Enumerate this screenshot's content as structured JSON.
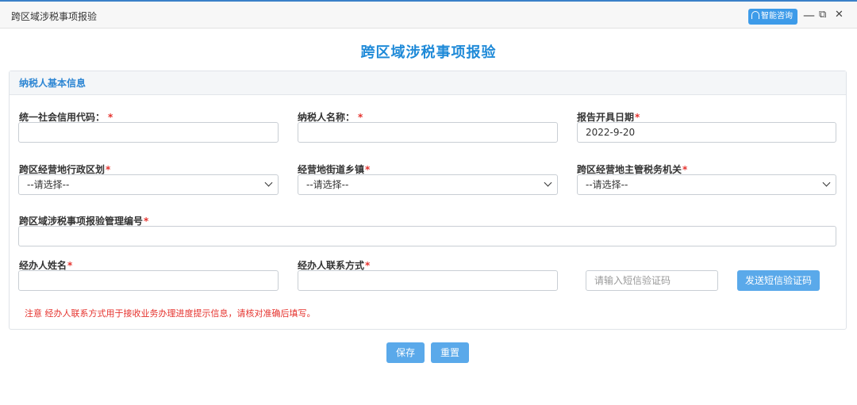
{
  "window": {
    "title": "跨区域涉税事项报验",
    "assist_label": "智能咨询",
    "minimize_glyph": "—",
    "restore_glyph": "⧉",
    "close_glyph": "✕"
  },
  "page": {
    "title": "跨区域涉税事项报验"
  },
  "panel": {
    "heading": "纳税人基本信息",
    "fields": {
      "credit_code": {
        "label": "统一社会信用代码：",
        "value": ""
      },
      "taxpayer_name": {
        "label": "纳税人名称：",
        "value": ""
      },
      "report_date": {
        "label": "报告开具日期",
        "value": "2022-9-20"
      },
      "admin_region": {
        "label": "跨区经营地行政区划",
        "selected": "--请选择--"
      },
      "street_town": {
        "label": "经营地街道乡镇",
        "selected": "--请选择--"
      },
      "tax_authority": {
        "label": "跨区经营地主管税务机关",
        "selected": "--请选择--"
      },
      "mgmt_number": {
        "label": "跨区域涉税事项报验管理编号",
        "value": ""
      },
      "agent_name": {
        "label": "经办人姓名",
        "value": ""
      },
      "agent_contact": {
        "label": "经办人联系方式",
        "value": ""
      },
      "sms_code": {
        "placeholder": "请输入短信验证码",
        "value": ""
      }
    },
    "required_mark": "*",
    "send_sms_label": "发送短信验证码",
    "notice": "注意 经办人联系方式用于接收业务办理进度提示信息，请核对准确后填写。"
  },
  "actions": {
    "save_label": "保存",
    "reset_label": "重置"
  },
  "colors": {
    "accent": "#1f8ad8",
    "button": "#5aa9ea",
    "required": "#e5322d"
  }
}
